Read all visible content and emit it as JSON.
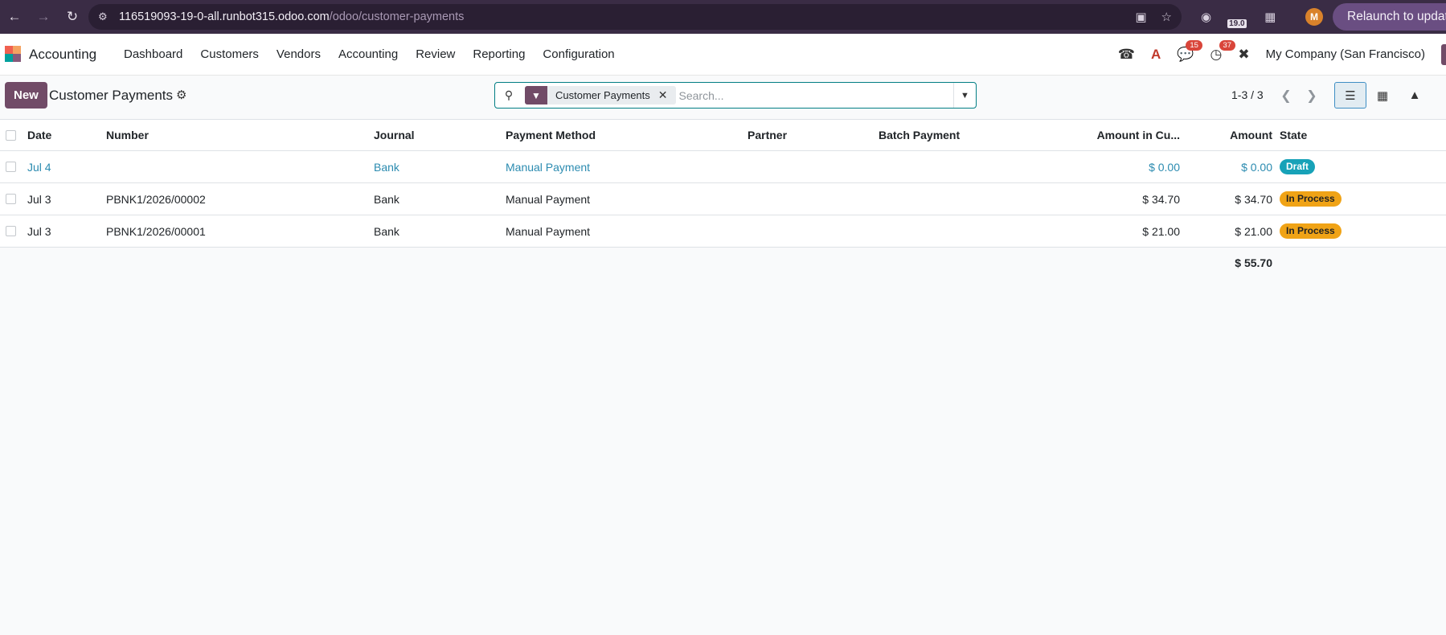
{
  "browser": {
    "url_host": "116519093-19-0-all.runbot315.odoo.com",
    "url_path": "/odoo/customer-payments",
    "version_badge": "19.0",
    "profile_initial": "M",
    "relaunch_label": "Relaunch to update"
  },
  "navbar": {
    "app_name": "Accounting",
    "menu": [
      "Dashboard",
      "Customers",
      "Vendors",
      "Accounting",
      "Review",
      "Reporting",
      "Configuration"
    ],
    "messages_count": "15",
    "activities_count": "37",
    "company": "My Company (San Francisco)"
  },
  "control_panel": {
    "new_label": "New",
    "title": "Customer Payments",
    "facet_label": "Customer Payments",
    "search_placeholder": "Search...",
    "pager": "1-3 / 3"
  },
  "list": {
    "columns": {
      "date": "Date",
      "number": "Number",
      "journal": "Journal",
      "method": "Payment Method",
      "partner": "Partner",
      "batch": "Batch Payment",
      "amount_currency": "Amount in Cu...",
      "amount": "Amount",
      "state": "State"
    },
    "rows": [
      {
        "date": "Jul 4",
        "number": "",
        "journal": "Bank",
        "method": "Manual Payment",
        "partner": "",
        "batch": "",
        "amount_currency": "$ 0.00",
        "amount": "$ 0.00",
        "state": "Draft"
      },
      {
        "date": "Jul 3",
        "number": "PBNK1/2026/00002",
        "journal": "Bank",
        "method": "Manual Payment",
        "partner": "",
        "batch": "",
        "amount_currency": "$ 34.70",
        "amount": "$ 34.70",
        "state": "In Process"
      },
      {
        "date": "Jul 3",
        "number": "PBNK1/2026/00001",
        "journal": "Bank",
        "method": "Manual Payment",
        "partner": "",
        "batch": "",
        "amount_currency": "$ 21.00",
        "amount": "$ 21.00",
        "state": "In Process"
      }
    ],
    "total_amount": "$ 55.70"
  },
  "colors": {
    "brand": "#714b67",
    "draft_link": "#2b8bb0",
    "badge_draft": "#17a2b8",
    "badge_in_process": "#f0a316"
  }
}
